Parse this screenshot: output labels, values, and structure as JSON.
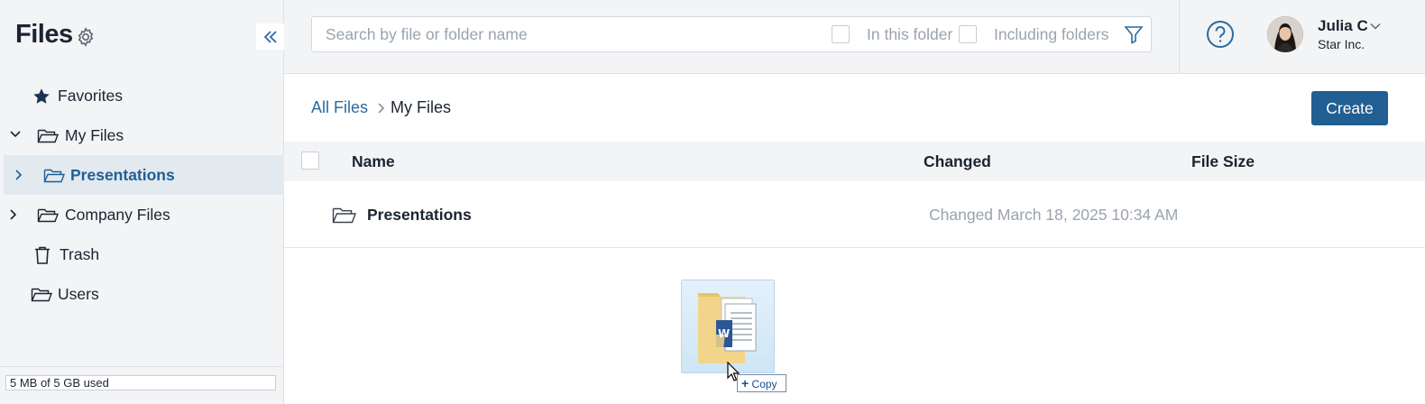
{
  "sidebar": {
    "title": "Files",
    "items": [
      {
        "label": "Favorites",
        "icon": "star-icon"
      },
      {
        "label": "My Files",
        "icon": "folder-icon",
        "expanded": true
      },
      {
        "label": "Presentations",
        "icon": "folder-icon",
        "active": true
      },
      {
        "label": "Company Files",
        "icon": "folder-icon"
      },
      {
        "label": "Trash",
        "icon": "trash-icon"
      },
      {
        "label": "Users",
        "icon": "folder-icon"
      }
    ],
    "storage": "5 MB of 5 GB used"
  },
  "search": {
    "placeholder": "Search by file or folder name",
    "in_folder_label": "In this folder",
    "including_folders_label": "Including folders"
  },
  "user": {
    "name": "Julia C",
    "org": "Star Inc."
  },
  "breadcrumb": {
    "root": "All Files",
    "current": "My Files"
  },
  "toolbar": {
    "create_label": "Create"
  },
  "table": {
    "headers": {
      "name": "Name",
      "changed": "Changed",
      "size": "File Size"
    },
    "rows": [
      {
        "name": "Presentations",
        "changed": "Changed March 18, 2025 10:34 AM",
        "size": ""
      }
    ]
  },
  "drag": {
    "tooltip": "Copy",
    "file_badge": "W"
  },
  "colors": {
    "accent": "#215f92",
    "link": "#2a6aa0",
    "sidebar_bg": "#f3f4f6",
    "active_bg": "#e2e9ef",
    "muted_text": "#9aa3ad"
  }
}
